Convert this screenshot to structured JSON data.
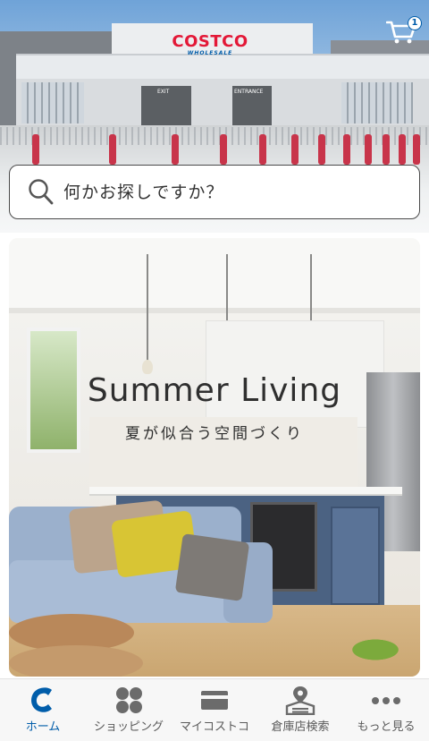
{
  "hero": {
    "logo_text": "COSTCO",
    "logo_subtext": "WHOLESALE",
    "exit_label": "EXIT",
    "entrance_label": "ENTRANCE"
  },
  "cart": {
    "icon": "shopping-cart-icon",
    "badge_count": "1"
  },
  "search": {
    "placeholder": "何かお探しですか？",
    "value": "",
    "icon": "search-icon"
  },
  "banner": {
    "title": "Summer Living",
    "subtitle": "夏が似合う空間づくり"
  },
  "tabbar": {
    "tabs": [
      {
        "label": "ホーム",
        "icon": "costco-c-icon",
        "active": true
      },
      {
        "label": "ショッピング",
        "icon": "grid-icon",
        "active": false
      },
      {
        "label": "マイコストコ",
        "icon": "membership-card-icon",
        "active": false
      },
      {
        "label": "倉庫店検索",
        "icon": "warehouse-location-icon",
        "active": false
      },
      {
        "label": "もっと見る",
        "icon": "more-dots-icon",
        "active": false
      }
    ]
  },
  "colors": {
    "brand_blue": "#005daa",
    "brand_red": "#e31837",
    "tab_inactive": "#5a5a5a"
  }
}
